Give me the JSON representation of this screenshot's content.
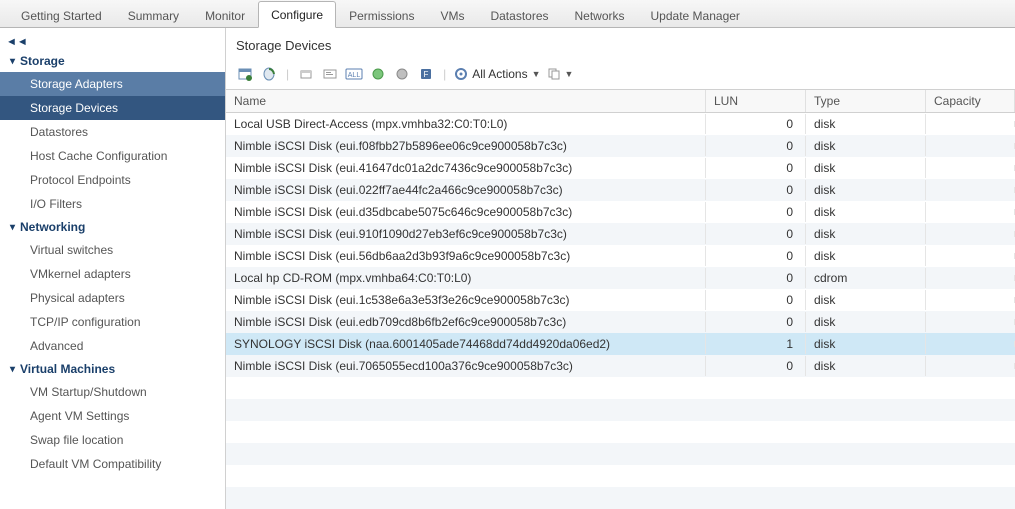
{
  "tabs": [
    {
      "label": "Getting Started"
    },
    {
      "label": "Summary"
    },
    {
      "label": "Monitor"
    },
    {
      "label": "Configure",
      "active": true
    },
    {
      "label": "Permissions"
    },
    {
      "label": "VMs"
    },
    {
      "label": "Datastores"
    },
    {
      "label": "Networks"
    },
    {
      "label": "Update Manager"
    }
  ],
  "sidebar": {
    "groups": [
      {
        "label": "Storage",
        "items": [
          {
            "label": "Storage Adapters",
            "highlight": true
          },
          {
            "label": "Storage Devices",
            "selected": true
          },
          {
            "label": "Datastores"
          },
          {
            "label": "Host Cache Configuration"
          },
          {
            "label": "Protocol Endpoints"
          },
          {
            "label": "I/O Filters"
          }
        ]
      },
      {
        "label": "Networking",
        "items": [
          {
            "label": "Virtual switches"
          },
          {
            "label": "VMkernel adapters"
          },
          {
            "label": "Physical adapters"
          },
          {
            "label": "TCP/IP configuration"
          },
          {
            "label": "Advanced"
          }
        ]
      },
      {
        "label": "Virtual Machines",
        "items": [
          {
            "label": "VM Startup/Shutdown"
          },
          {
            "label": "Agent VM Settings"
          },
          {
            "label": "Swap file location"
          },
          {
            "label": "Default VM Compatibility"
          }
        ]
      }
    ]
  },
  "content": {
    "title": "Storage Devices",
    "toolbar": {
      "all_actions_label": "All Actions"
    },
    "columns": {
      "name": "Name",
      "lun": "LUN",
      "type": "Type",
      "capacity": "Capacity"
    },
    "rows": [
      {
        "name": "Local USB Direct-Access (mpx.vmhba32:C0:T0:L0)",
        "lun": "0",
        "type": "disk",
        "capacity": ""
      },
      {
        "name": "Nimble iSCSI Disk (eui.f08fbb27b5896ee06c9ce900058b7c3c)",
        "lun": "0",
        "type": "disk",
        "capacity": ""
      },
      {
        "name": "Nimble iSCSI Disk (eui.41647dc01a2dc7436c9ce900058b7c3c)",
        "lun": "0",
        "type": "disk",
        "capacity": ""
      },
      {
        "name": "Nimble iSCSI Disk (eui.022ff7ae44fc2a466c9ce900058b7c3c)",
        "lun": "0",
        "type": "disk",
        "capacity": ""
      },
      {
        "name": "Nimble iSCSI Disk (eui.d35dbcabe5075c646c9ce900058b7c3c)",
        "lun": "0",
        "type": "disk",
        "capacity": ""
      },
      {
        "name": "Nimble iSCSI Disk (eui.910f1090d27eb3ef6c9ce900058b7c3c)",
        "lun": "0",
        "type": "disk",
        "capacity": ""
      },
      {
        "name": "Nimble iSCSI Disk (eui.56db6aa2d3b93f9a6c9ce900058b7c3c)",
        "lun": "0",
        "type": "disk",
        "capacity": ""
      },
      {
        "name": "Local hp CD-ROM (mpx.vmhba64:C0:T0:L0)",
        "lun": "0",
        "type": "cdrom",
        "capacity": ""
      },
      {
        "name": "Nimble iSCSI Disk (eui.1c538e6a3e53f3e26c9ce900058b7c3c)",
        "lun": "0",
        "type": "disk",
        "capacity": ""
      },
      {
        "name": "Nimble iSCSI Disk (eui.edb709cd8b6fb2ef6c9ce900058b7c3c)",
        "lun": "0",
        "type": "disk",
        "capacity": ""
      },
      {
        "name": "SYNOLOGY iSCSI Disk (naa.6001405ade74468dd74dd4920da06ed2)",
        "lun": "1",
        "type": "disk",
        "capacity": "",
        "selected": true
      },
      {
        "name": "Nimble iSCSI Disk (eui.7065055ecd100a376c9ce900058b7c3c)",
        "lun": "0",
        "type": "disk",
        "capacity": ""
      }
    ]
  }
}
